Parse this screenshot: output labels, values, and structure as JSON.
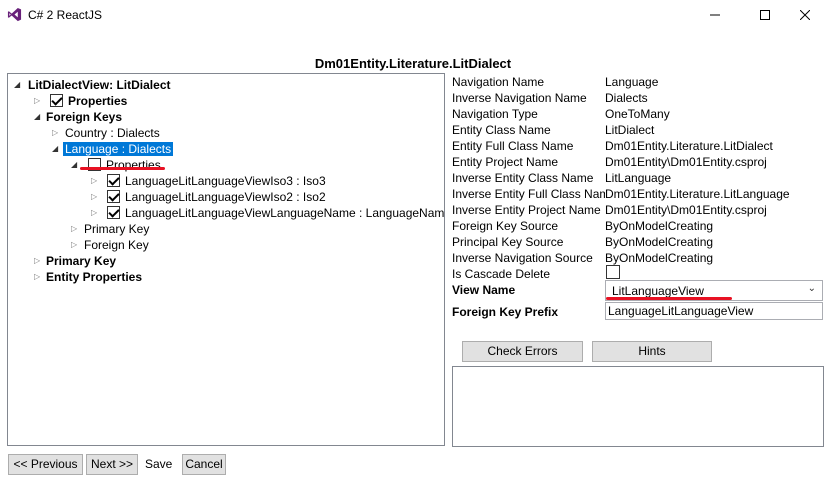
{
  "window": {
    "title": "C# 2 ReactJS",
    "icon": "visual-studio-icon",
    "controls": [
      "minimize-icon",
      "maximize-icon",
      "close-icon"
    ]
  },
  "page_title": "Dm01Entity.Literature.LitDialect",
  "tree": {
    "root": "LitDialectView: LitDialect",
    "properties": "Properties",
    "foreign_keys": "Foreign Keys",
    "country": "Country : Dialects",
    "language": "Language : Dialects",
    "lang_properties": "Properties",
    "iso3": "LanguageLitLanguageViewIso3 : Iso3",
    "iso2": "LanguageLitLanguageViewIso2 : Iso2",
    "language_name": "LanguageLitLanguageViewLanguageName : LanguageName",
    "lang_primary_key": "Primary Key",
    "lang_foreign_key": "Foreign Key",
    "primary_key": "Primary Key",
    "entity_properties": "Entity Properties"
  },
  "properties": [
    {
      "label": "Navigation Name",
      "value": "Language"
    },
    {
      "label": "Inverse Navigation Name",
      "value": "Dialects"
    },
    {
      "label": "Navigation Type",
      "value": "OneToMany"
    },
    {
      "label": "Entity Class Name",
      "value": "LitDialect"
    },
    {
      "label": "Entity Full Class Name",
      "value": "Dm01Entity.Literature.LitDialect"
    },
    {
      "label": "Entity Project Name",
      "value": "Dm01Entity\\Dm01Entity.csproj"
    },
    {
      "label": "Inverse Entity Class Name",
      "value": "LitLanguage"
    },
    {
      "label": "Inverse Entity Full Class Name",
      "value": "Dm01Entity.Literature.LitLanguage"
    },
    {
      "label": "Inverse Entity Project Name",
      "value": "Dm01Entity\\Dm01Entity.csproj"
    },
    {
      "label": "Foreign Key Source",
      "value": "ByOnModelCreating"
    },
    {
      "label": "Principal Key Source",
      "value": "ByOnModelCreating"
    },
    {
      "label": "Inverse Navigation Source",
      "value": "ByOnModelCreating"
    }
  ],
  "cascade_delete_label": "Is Cascade Delete",
  "view_name_label": "View Name",
  "view_name_value": "LitLanguageView",
  "fk_prefix_label": "Foreign Key Prefix",
  "fk_prefix_value": "LanguageLitLanguageView",
  "buttons": {
    "check_errors": "Check Errors",
    "hints": "Hints",
    "previous": "<< Previous",
    "next": "Next >>",
    "save": "Save",
    "cancel": "Cancel"
  },
  "colors": {
    "selection": "#0078d7",
    "annotation_red": "#e81123"
  }
}
